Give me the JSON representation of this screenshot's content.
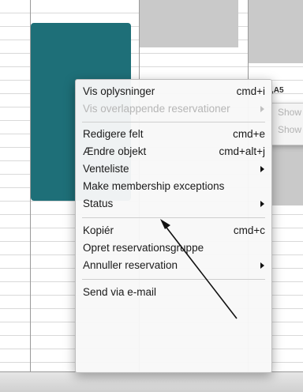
{
  "calendar": {
    "cell_label": ",A5",
    "submenu_items": [
      "Show",
      "Show"
    ]
  },
  "context_menu": {
    "items": [
      {
        "label": "Vis oplysninger",
        "shortcut": "cmd+i"
      },
      {
        "label": "Vis overlappende reservationer",
        "has_submenu": true,
        "disabled": true
      },
      {
        "label": "Redigere felt",
        "shortcut": "cmd+e"
      },
      {
        "label": "Ændre objekt",
        "shortcut": "cmd+alt+j"
      },
      {
        "label": "Venteliste",
        "has_submenu": true
      },
      {
        "label": "Make membership exceptions"
      },
      {
        "label": "Status",
        "has_submenu": true
      },
      {
        "label": "Kopiér",
        "shortcut": "cmd+c"
      },
      {
        "label": "Opret reservationsgruppe"
      },
      {
        "label": "Annuller reservation",
        "has_submenu": true
      },
      {
        "label": "Send via e-mail"
      }
    ]
  },
  "colors": {
    "reservation": "#1e6f78",
    "blocked": "#c9c9c9",
    "annotation_arrow": "#111111"
  }
}
